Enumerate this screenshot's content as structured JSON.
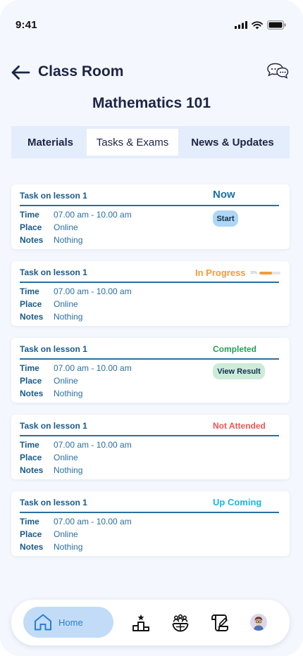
{
  "status_bar": {
    "time": "9:41"
  },
  "header": {
    "title": "Class Room"
  },
  "course": {
    "title": "Mathematics 101"
  },
  "tabs": [
    {
      "label": "Materials"
    },
    {
      "label": "Tasks & Exams"
    },
    {
      "label": "News & Updates"
    }
  ],
  "active_tab": "Tasks & Exams",
  "labels": {
    "time": "Time",
    "place": "Place",
    "notes": "Notes"
  },
  "tasks": [
    {
      "title": "Task on lesson 1",
      "status": "Now",
      "time": "07.00 am - 10.00 am",
      "place": "Online",
      "notes": "Nothing",
      "action": "Start"
    },
    {
      "title": "Task on lesson 1",
      "status": "In Progress",
      "progress_label": "30%",
      "progress": 0.6,
      "time": "07.00 am - 10.00 am",
      "place": "Online",
      "notes": "Nothing"
    },
    {
      "title": "Task on lesson 1",
      "status": "Completed",
      "time": "07.00 am - 10.00 am",
      "place": "Online",
      "notes": "Nothing",
      "action": "View Result"
    },
    {
      "title": "Task on lesson 1",
      "status": "Not Attended",
      "time": "07.00 am - 10.00 am",
      "place": "Online",
      "notes": "Nothing"
    },
    {
      "title": "Task on lesson 1",
      "status": "Up Coming",
      "time": "07.00 am - 10.00 am",
      "place": "Online",
      "notes": "Nothing"
    }
  ],
  "bottom_nav": {
    "home_label": "Home",
    "items": [
      "home-icon",
      "leaderboard-icon",
      "community-icon",
      "assignment-icon",
      "avatar"
    ]
  },
  "colors": {
    "accent": "#2a7dd0",
    "now": "#1a6ea8",
    "in_progress": "#f39a3c",
    "completed": "#23a058",
    "not_attended": "#ef5454",
    "up_coming": "#1db5e3"
  }
}
